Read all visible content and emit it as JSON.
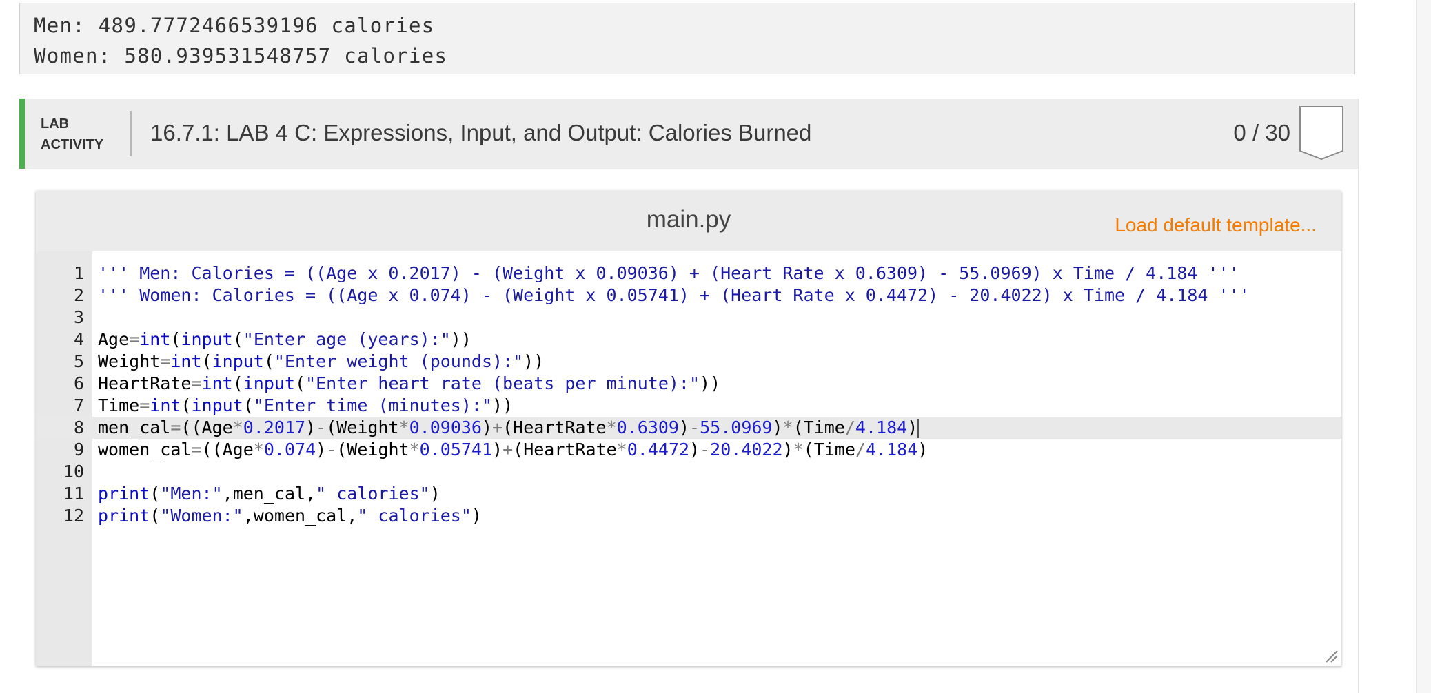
{
  "output": {
    "lines": [
      "Men: 489.7772466539196 calories",
      "Women: 580.939531548757 calories"
    ]
  },
  "lab": {
    "tag_line1": "LAB",
    "tag_line2": "ACTIVITY",
    "title": "16.7.1: LAB 4 C: Expressions, Input, and Output: Calories Burned",
    "score": "0 / 30",
    "accent_color": "#4caf50"
  },
  "editor": {
    "filename": "main.py",
    "load_template_label": "Load default template...",
    "active_line": 8,
    "lines": [
      {
        "num": "1",
        "code": "''' Men: Calories = ((Age x 0.2017) - (Weight x 0.09036) + (Heart Rate x 0.6309) - 55.0969) x Time / 4.184 '''"
      },
      {
        "num": "2",
        "code": "''' Women: Calories = ((Age x 0.074) - (Weight x 0.05741) + (Heart Rate x 0.4472) - 20.4022) x Time / 4.184 '''"
      },
      {
        "num": "3",
        "code": ""
      },
      {
        "num": "4",
        "code": "Age=int(input(\"Enter age (years):\"))"
      },
      {
        "num": "5",
        "code": "Weight=int(input(\"Enter weight (pounds):\"))"
      },
      {
        "num": "6",
        "code": "HeartRate=int(input(\"Enter heart rate (beats per minute):\"))"
      },
      {
        "num": "7",
        "code": "Time=int(input(\"Enter time (minutes):\"))"
      },
      {
        "num": "8",
        "code": "men_cal=((Age*0.2017)-(Weight*0.09036)+(HeartRate*0.6309)-55.0969)*(Time/4.184)"
      },
      {
        "num": "9",
        "code": "women_cal=((Age*0.074)-(Weight*0.05741)+(HeartRate*0.4472)-20.4022)*(Time/4.184)"
      },
      {
        "num": "10",
        "code": ""
      },
      {
        "num": "11",
        "code": "print(\"Men:\",men_cal,\" calories\")"
      },
      {
        "num": "12",
        "code": "print(\"Women:\",women_cal,\" calories\")"
      }
    ]
  }
}
